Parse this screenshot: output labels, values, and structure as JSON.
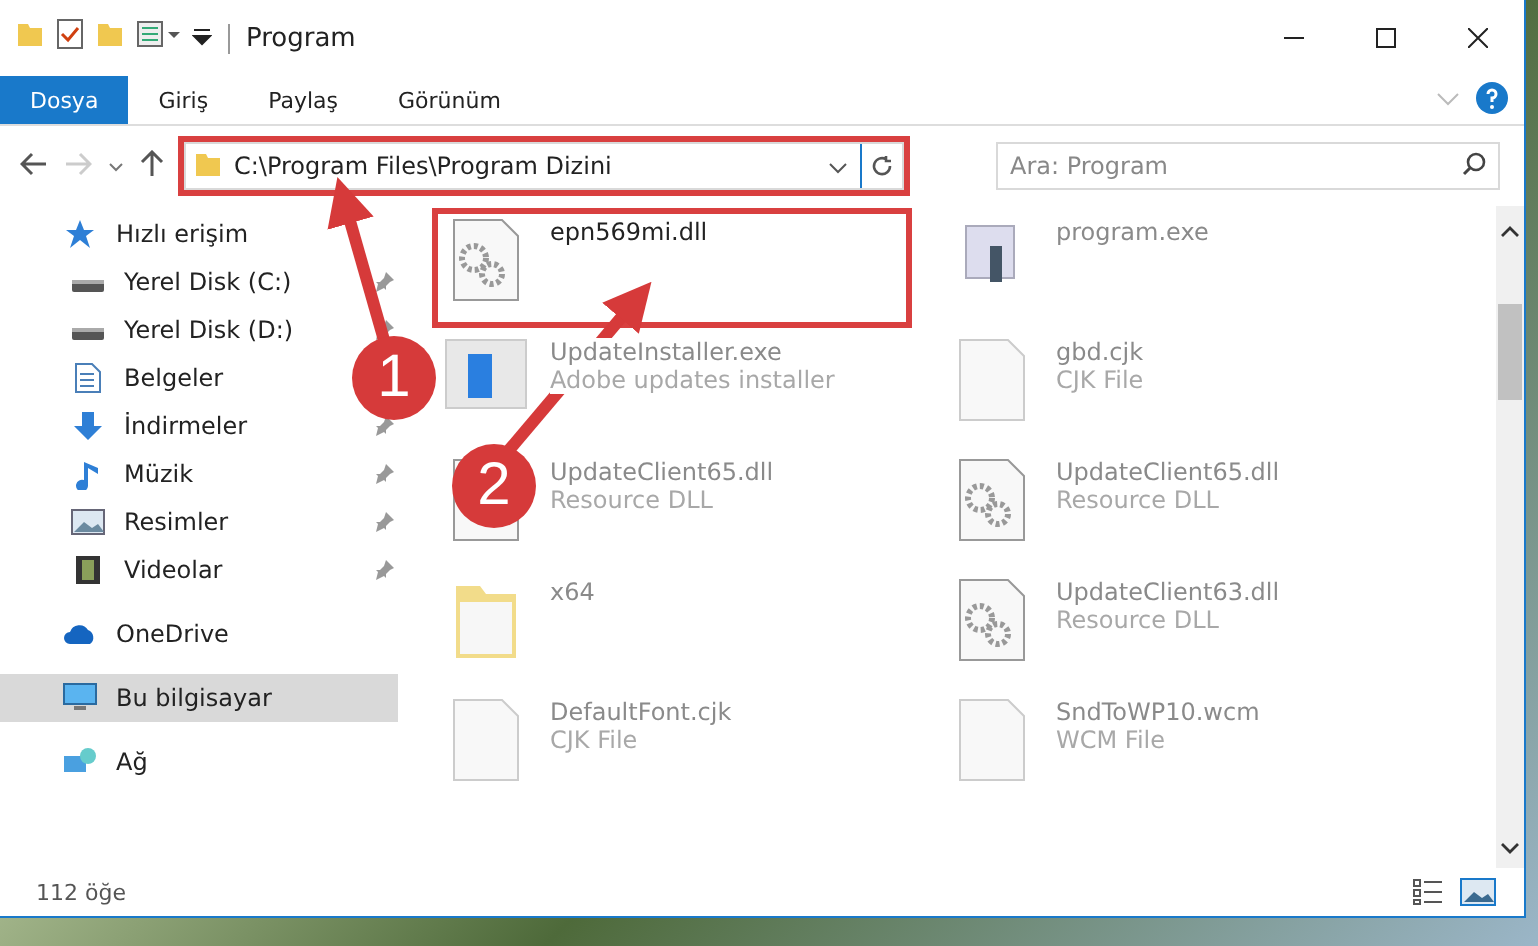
{
  "window": {
    "title": "Program"
  },
  "ribbon_tabs": [
    {
      "label": "Dosya",
      "selected": true
    },
    {
      "label": "Giriş",
      "selected": false
    },
    {
      "label": "Paylaş",
      "selected": false
    },
    {
      "label": "Görünüm",
      "selected": false
    }
  ],
  "address_bar": {
    "path": "C:\\Program Files\\Program Dizini",
    "highlighted": true
  },
  "search": {
    "placeholder": "Ara: Program"
  },
  "sidebar": {
    "items": [
      {
        "label": "Hızlı erişim",
        "selected": false,
        "children": [
          {
            "label": "Yerel Disk (C:)"
          },
          {
            "label": "Yerel Disk (D:)"
          },
          {
            "label": "Belgeler"
          },
          {
            "label": "İndirmeler"
          },
          {
            "label": "Müzik"
          },
          {
            "label": "Resimler"
          },
          {
            "label": "Videolar"
          }
        ]
      },
      {
        "label": "OneDrive",
        "selected": false
      },
      {
        "label": "Bu bilgisayar",
        "selected": true
      },
      {
        "label": "Ağ",
        "selected": false
      }
    ]
  },
  "files": [
    {
      "name": "epn569mi.dll",
      "highlighted": true,
      "dimmed": false
    },
    {
      "name": "program.exe",
      "highlighted": false,
      "dimmed": true
    },
    {
      "name": "UpdateInstaller.exe",
      "type": "Adobe updates installer",
      "highlighted": false,
      "dimmed": true
    },
    {
      "name": "gbd.cjk",
      "type": "CJK File",
      "highlighted": false,
      "dimmed": true
    },
    {
      "name": "UpdateClient65.dll",
      "type": "Resource DLL",
      "highlighted": false,
      "dimmed": true
    },
    {
      "name": "UpdateClient65.dll",
      "type": "Resource DLL",
      "highlighted": false,
      "dimmed": true
    },
    {
      "name": "x64",
      "highlighted": false,
      "dimmed": true
    },
    {
      "name": "UpdateClient63.dll",
      "type": "Resource DLL",
      "highlighted": false,
      "dimmed": true
    },
    {
      "name": "DefaultFont.cjk",
      "type": "CJK File",
      "highlighted": false,
      "dimmed": true
    },
    {
      "name": "SndToWP10.wcm",
      "type": "WCM File",
      "highlighted": false,
      "dimmed": true
    }
  ],
  "status_bar": {
    "item_count": "112 öğe"
  },
  "annotations": [
    {
      "label": "1"
    },
    {
      "label": "2"
    }
  ]
}
